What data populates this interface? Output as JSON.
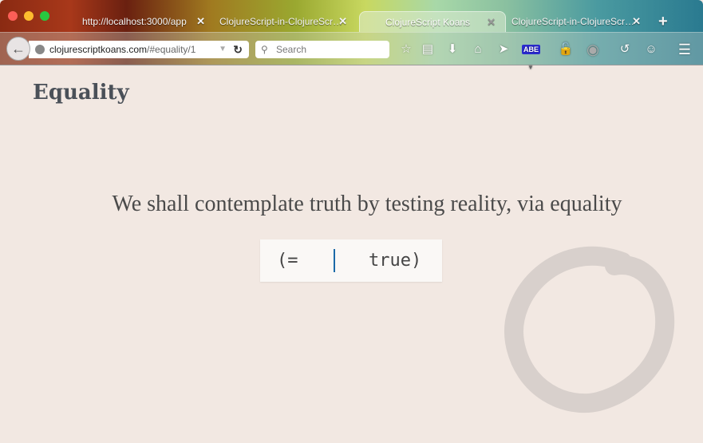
{
  "browser": {
    "tabs": [
      {
        "label": "http://localhost:3000/app",
        "active": false
      },
      {
        "label": "ClojureScript-in-ClojureScr…",
        "active": false
      },
      {
        "label": "ClojureScript Koans",
        "active": true
      },
      {
        "label": "ClojureScript-in-ClojureScr…",
        "active": false
      }
    ],
    "close_glyph": "✕",
    "new_tab": "+",
    "url_domain": "clojurescriptkoans.com",
    "url_path": "/#equality/1",
    "search_placeholder": "Search",
    "toolbar_icons": [
      "bookmark-star-icon",
      "reading-list-icon",
      "download-icon",
      "home-icon",
      "send-icon",
      "adblock-icon",
      "lock-icon",
      "circle-addon-icon",
      "history-icon",
      "chat-icon",
      "menu-icon"
    ]
  },
  "page": {
    "title": "Equality",
    "description": "We shall contemplate truth by testing reality, via equality",
    "code_open": "(=",
    "code_input": "",
    "code_close": "true)"
  }
}
